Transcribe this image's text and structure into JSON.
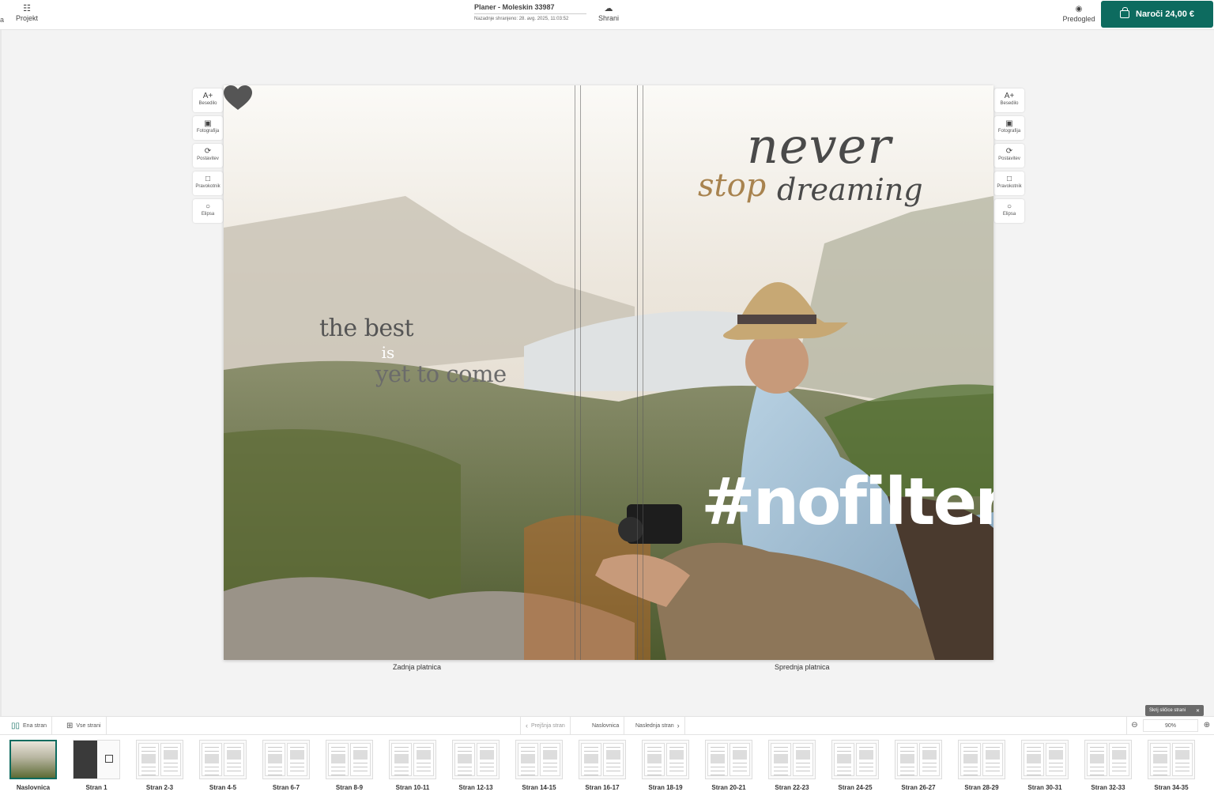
{
  "topbar": {
    "left_label": "a",
    "project_label": "Projekt",
    "doc_title": "Planer - Moleskin 33987",
    "last_saved": "Nazadnje shranjeno: 28. avg. 2025, 11:03:52",
    "save_label": "Shrani",
    "preview_label": "Predogled",
    "order_label": "Naroči  24,00 €"
  },
  "tools": [
    "Besedilo",
    "Fotografija",
    "Postavitev",
    "Pravokotnik",
    "Elipsa"
  ],
  "cover": {
    "back_text_1": "the best",
    "back_text_2": "is",
    "back_text_3": "yet to come",
    "front_text_1": "never",
    "front_text_2": "stop",
    "front_text_3": "dreaming",
    "front_text_4": "#nofilter",
    "back_caption": "Zadnja platnica",
    "front_caption": "Sprednja platnica"
  },
  "navbar": {
    "single_page": "Ena stran",
    "all_pages": "Vse strani",
    "prev": "Prejšnja stran",
    "current": "Naslovnica",
    "next": "Naslednja stran",
    "zoom": "90%",
    "hide_thumbs": "Skrij sličice strani"
  },
  "thumbnails": [
    "Naslovnica",
    "Stran 1",
    "Stran 2-3",
    "Stran 4-5",
    "Stran 6-7",
    "Stran 8-9",
    "Stran 10-11",
    "Stran 12-13",
    "Stran 14-15",
    "Stran 16-17",
    "Stran 18-19",
    "Stran 20-21",
    "Stran 22-23",
    "Stran 24-25",
    "Stran 26-27",
    "Stran 28-29",
    "Stran 30-31",
    "Stran 32-33",
    "Stran 34-35"
  ],
  "colors": {
    "accent": "#0d6b5f"
  }
}
